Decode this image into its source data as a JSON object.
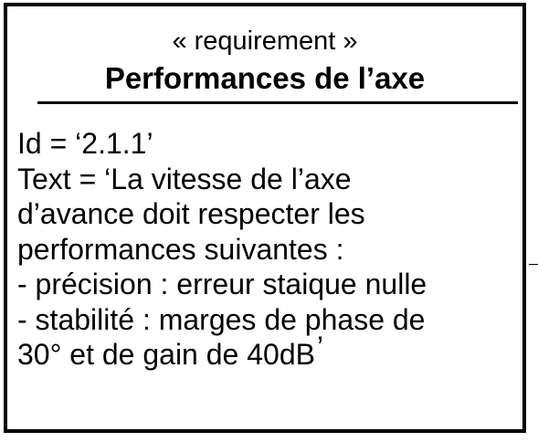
{
  "requirement": {
    "stereotype": "« requirement »",
    "name": "Performances de l’axe",
    "id_line": "Id = ‘2.1.1’",
    "text_lines": [
      "Text = ‘La vitesse de l’axe",
      "d’avance doit respecter les",
      "performances suivantes :",
      "- précision : erreur staique nulle",
      "- stabilité : marges de phase de",
      "30° et de gain de 40dB"
    ],
    "text_close_quote": "’"
  }
}
